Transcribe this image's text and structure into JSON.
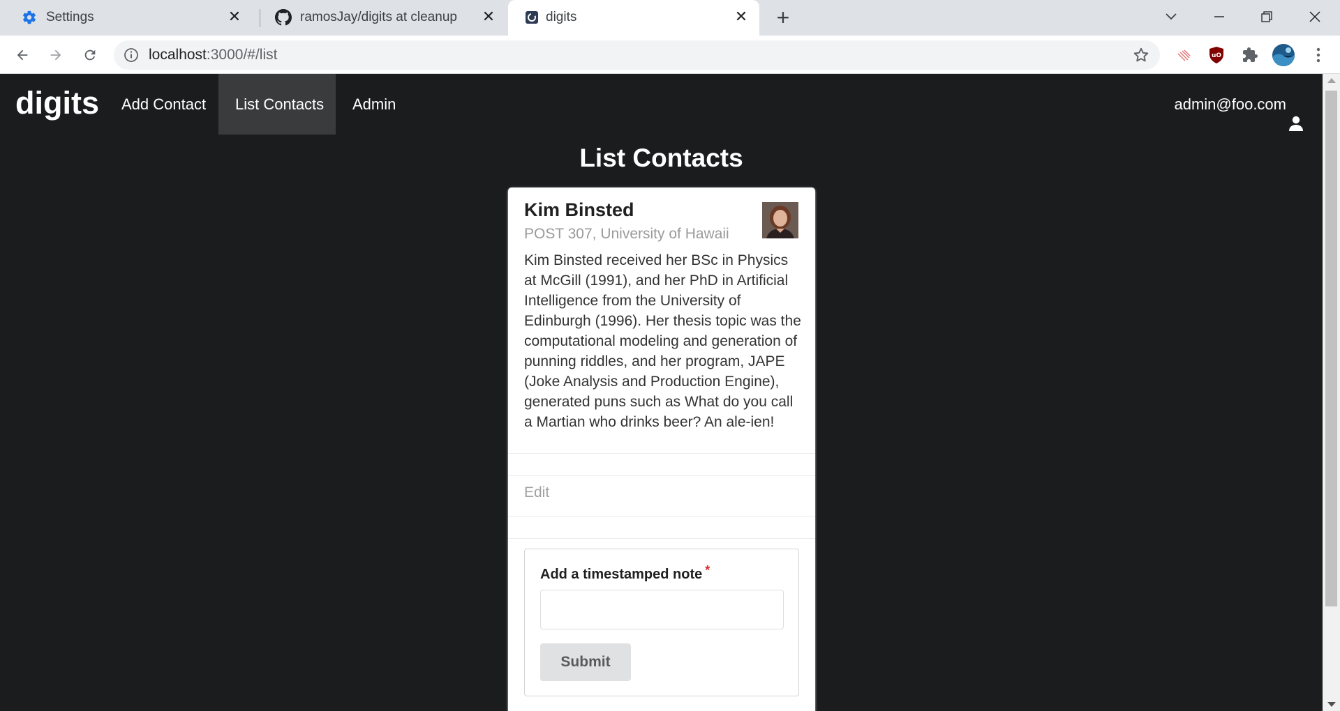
{
  "browser": {
    "tabs": [
      {
        "title": "Settings",
        "icon": "gear-icon"
      },
      {
        "title": "ramosJay/digits at cleanup",
        "icon": "github-icon"
      },
      {
        "title": "digits",
        "icon": "app-favicon"
      }
    ],
    "active_tab": 2,
    "url_host": "localhost",
    "url_rest": ":3000/#/list"
  },
  "navbar": {
    "brand": "digits",
    "items": [
      {
        "label": "Add Contact",
        "active": false
      },
      {
        "label": "List Contacts",
        "active": true
      },
      {
        "label": "Admin",
        "active": false
      }
    ],
    "user": "admin@foo.com"
  },
  "page": {
    "title": "List Contacts"
  },
  "contact": {
    "name": "Kim Binsted",
    "address": "POST 307, University of Hawaii",
    "description": "Kim Binsted received her BSc in Physics at McGill (1991), and her PhD in Artificial Intelligence from the University of Edinburgh (1996). Her thesis topic was the computational modeling and generation of punning riddles, and her program, JAPE (Joke Analysis and Production Engine), generated puns such as What do you call a Martian who drinks beer? An ale-ien!",
    "edit_label": "Edit"
  },
  "note_form": {
    "label": "Add a timestamped note",
    "required_mark": "*",
    "value": "",
    "submit_label": "Submit"
  },
  "colors": {
    "background": "#1b1c1d",
    "active_menu": "#3a3b3c",
    "required": "#db2828"
  }
}
